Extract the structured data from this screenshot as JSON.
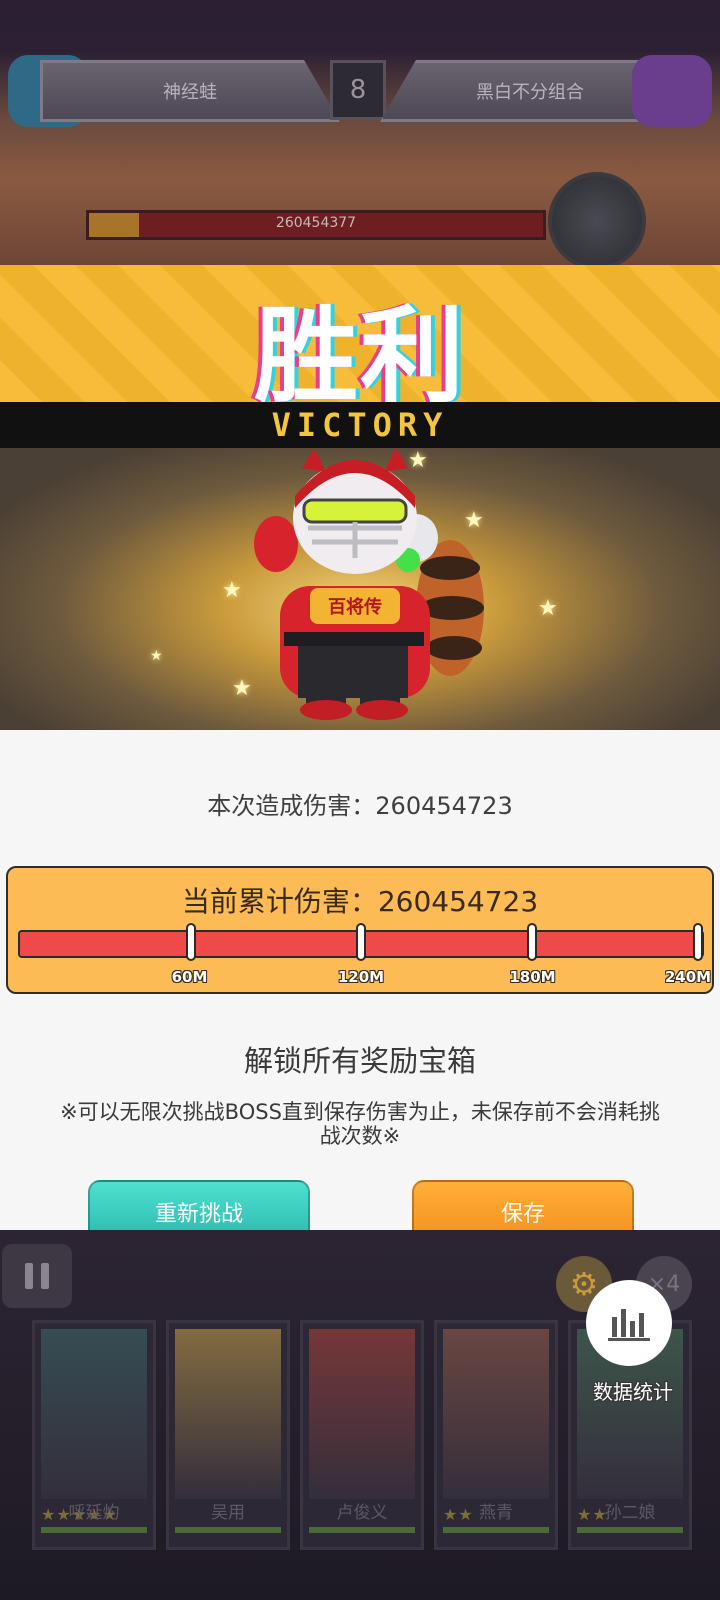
{
  "battle_hud": {
    "team_left": "神经蛙",
    "team_right": "黑白不分组合",
    "round": "8",
    "boss_hp_text": "260454377"
  },
  "banner": {
    "title": "胜利",
    "subtitle": "VICTORY"
  },
  "result": {
    "this_damage_label": "本次造成伤害：",
    "this_damage_value": "260454723",
    "total_damage_label": "当前累计伤害：",
    "total_damage_value": "260454723",
    "progress_fraction": 1.0,
    "milestones": [
      "60M",
      "120M",
      "180M",
      "240M"
    ],
    "unlock_text": "解锁所有奖励宝箱",
    "hint_text": "※可以无限次挑战BOSS直到保存伤害为止，未保存前不会消耗挑战次数※",
    "retry_label": "重新挑战",
    "save_label": "保存"
  },
  "bottom_hud": {
    "speed_label": "×4",
    "stats_label": "数据统计",
    "heroes": [
      {
        "name": "呼延灼",
        "stars": "★★★★★"
      },
      {
        "name": "吴用",
        "stars": ""
      },
      {
        "name": "卢俊义",
        "stars": ""
      },
      {
        "name": "燕青",
        "stars": "★★"
      },
      {
        "name": "孙二娘",
        "stars": "★★"
      }
    ]
  },
  "colors": {
    "banner_yellow": "#f6b82e",
    "progress_red": "#ee4a4a",
    "progress_box": "#fdbb55",
    "retry_teal": "#2bb8ac",
    "save_orange": "#f58e1c"
  }
}
